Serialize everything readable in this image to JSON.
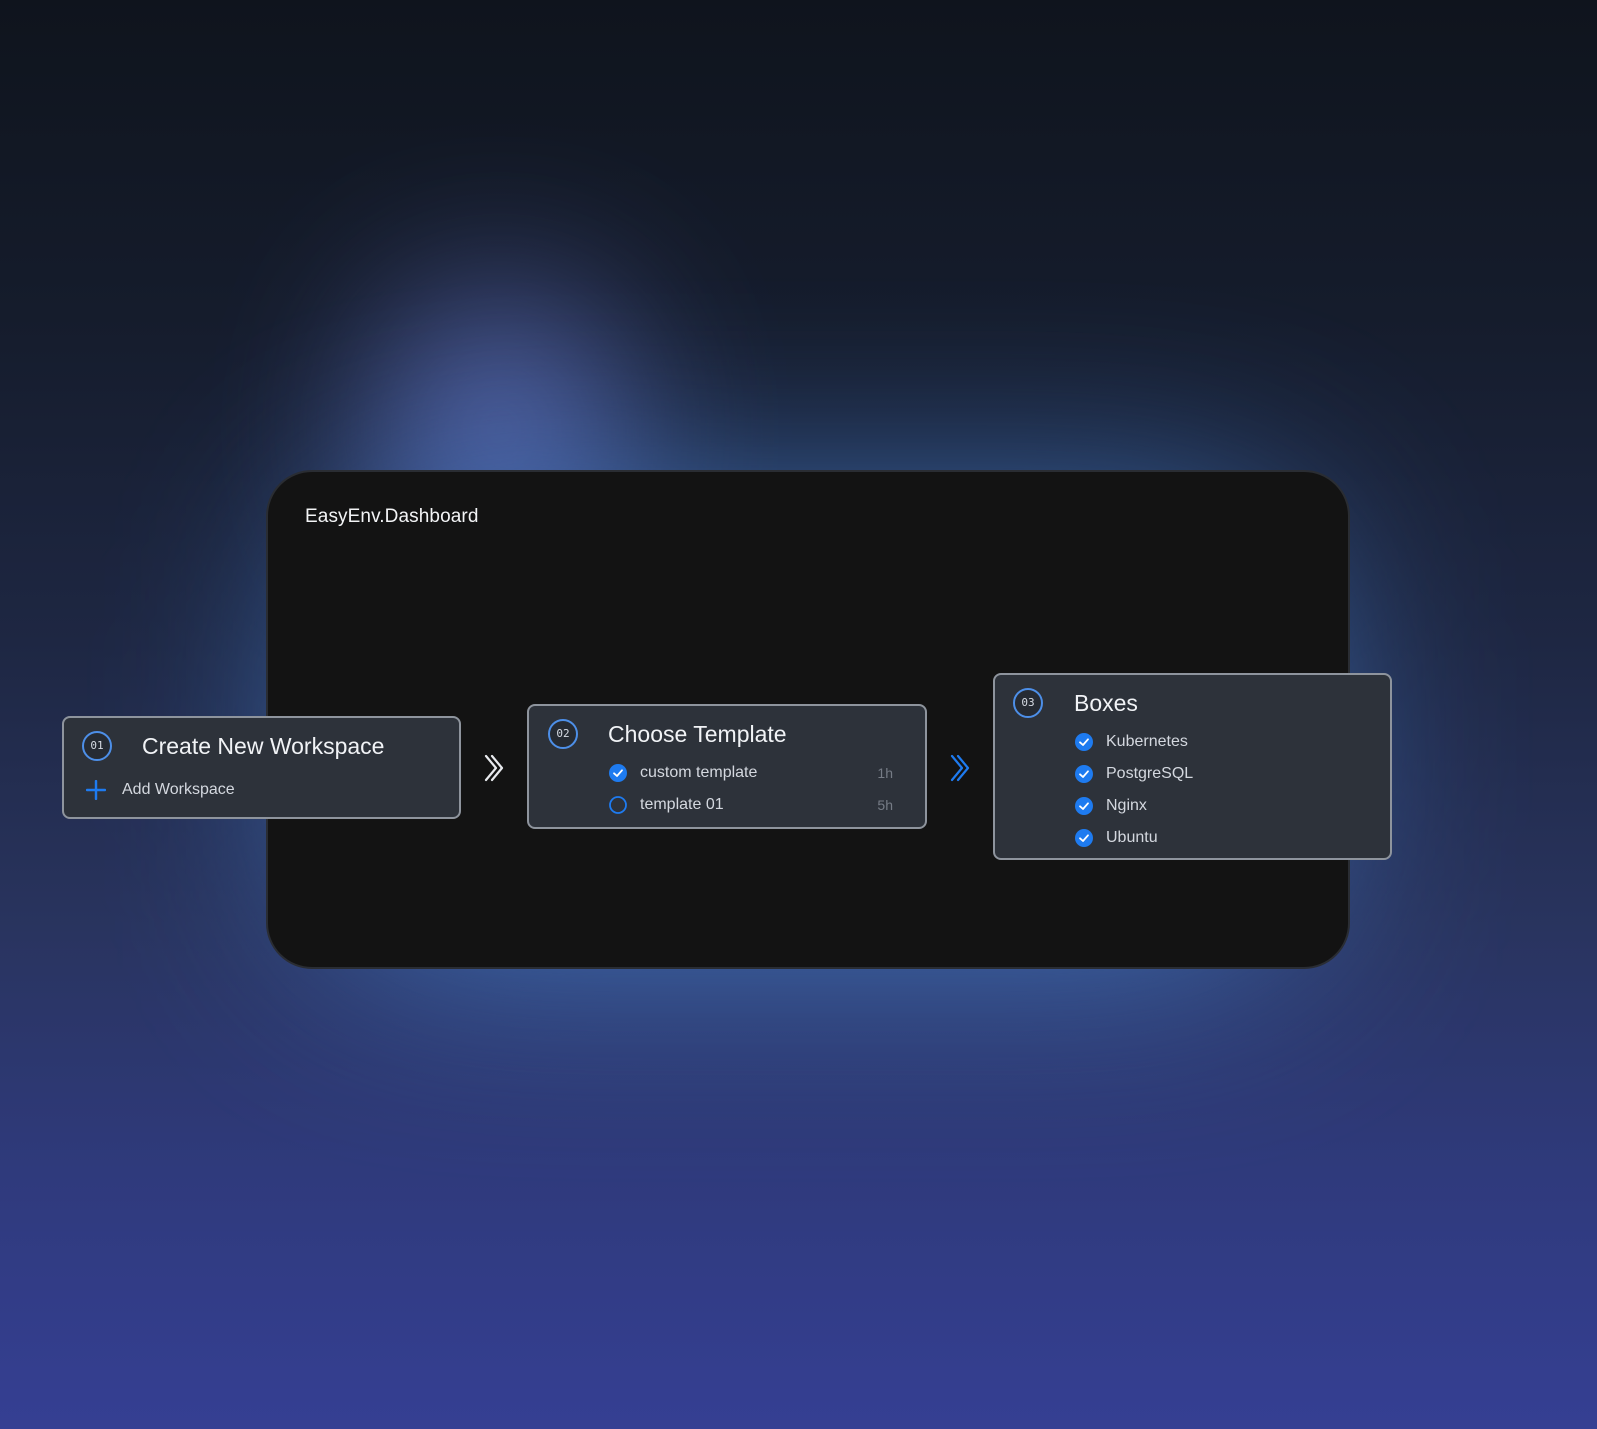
{
  "dashboard": {
    "title": "EasyEnv.Dashboard"
  },
  "steps": [
    {
      "number": "01",
      "title": "Create New Workspace",
      "action_label": "Add Workspace",
      "action_icon": "plus-icon"
    },
    {
      "number": "02",
      "title": "Choose Template",
      "options": [
        {
          "label": "custom template",
          "time": "1h",
          "selected": true
        },
        {
          "label": "template 01",
          "time": "5h",
          "selected": false
        }
      ]
    },
    {
      "number": "03",
      "title": "Boxes",
      "items": [
        {
          "label": "Kubernetes",
          "checked": true
        },
        {
          "label": "PostgreSQL",
          "checked": true
        },
        {
          "label": "Nginx",
          "checked": true
        },
        {
          "label": "Ubuntu",
          "checked": true
        }
      ]
    }
  ],
  "icons": {
    "step_arrow": "double-chevron-right-icon",
    "checked": "check-circle-icon",
    "unchecked": "empty-circle-icon"
  },
  "colors": {
    "accent": "#1e7bf0",
    "card_bg": "#2d323a",
    "card_border": "#8e949d",
    "dashboard_bg": "#131313",
    "glow": "#4a86d8"
  }
}
